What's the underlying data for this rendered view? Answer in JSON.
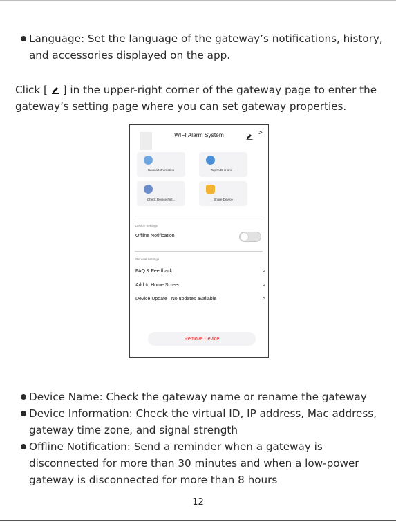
{
  "bullets_top": [
    {
      "text": "Language: Set the language of the gateway’s notifications, history, and accessories displayed on the app."
    }
  ],
  "paragraph": {
    "before_icon": "Click [ ",
    "icon": "pencil-icon",
    "after_icon": " ] in the upper-right corner of the gateway page to enter the gateway’s setting page where you can set gateway properties."
  },
  "phone": {
    "title": "WIFI Alarm System",
    "header_chevron": ">",
    "tiles": [
      {
        "label": "Device Information",
        "icon": "info-icon",
        "color": "#6fa7e2"
      },
      {
        "label": "Tap-to-Run and ...",
        "icon": "automation-icon",
        "color": "#4b8fd9"
      },
      {
        "label": "Check Device Net...",
        "icon": "network-check-icon",
        "color": "#6a8cc9"
      },
      {
        "label": "Share Device",
        "icon": "share-icon",
        "color": "#f2b234"
      }
    ],
    "device_settings": {
      "section_label": "Device Settings",
      "offline_label": "Offline Notification",
      "offline_enabled": false
    },
    "general_settings": {
      "section_label": "General Settings",
      "rows": [
        {
          "label": "FAQ & Feedback",
          "chevron": ">"
        },
        {
          "label": "Add to Home Screen",
          "chevron": ">"
        },
        {
          "label": "Device Update   No updates available",
          "chevron": ">"
        }
      ]
    },
    "remove_button": "Remove Device",
    "remove_color": "#e0242a"
  },
  "bullets_bottom": [
    {
      "text": "Device Name: Check the gateway name or rename the gateway"
    },
    {
      "text": "Device Information: Check the virtual ID, IP address, Mac address, gateway time zone, and signal strength"
    },
    {
      "text": "Offline Notification: Send a reminder when a gateway is disconnected  for more than 30 minutes and when a low-power gateway is disconnected for more than 8 hours"
    }
  ],
  "page_number": "12"
}
